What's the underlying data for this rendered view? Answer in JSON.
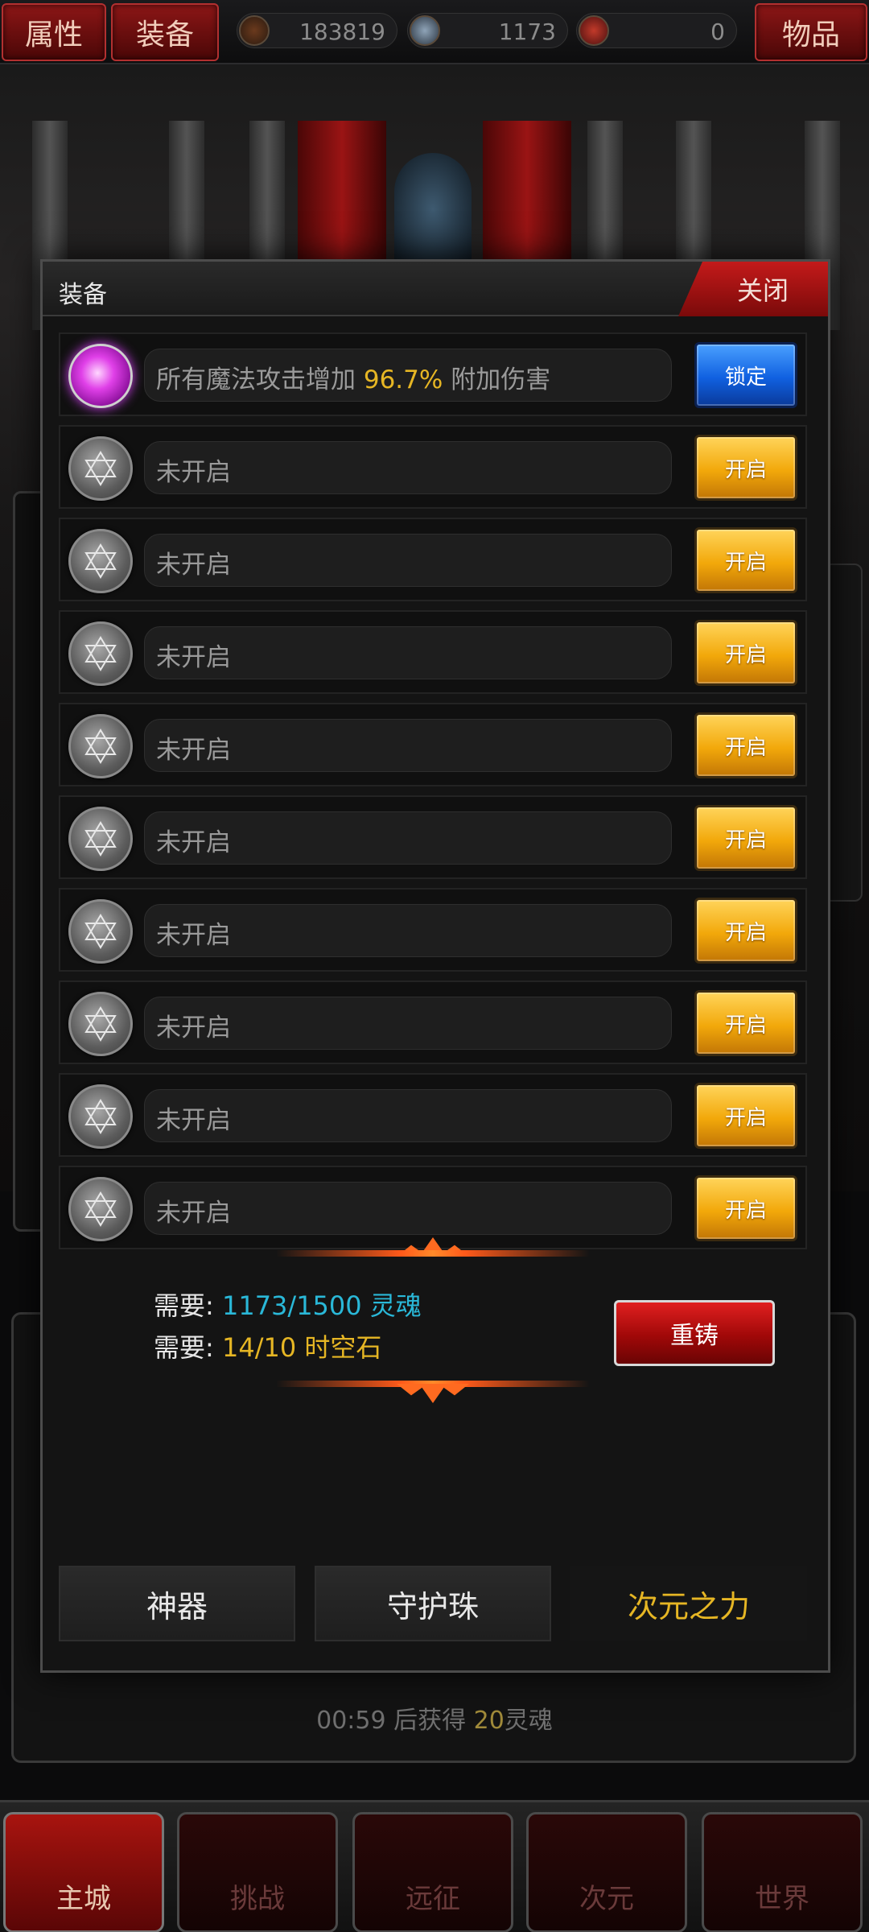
{
  "topbar": {
    "attributes_label": "属性",
    "equipment_label": "装备",
    "items_label": "物品",
    "gold": "183819",
    "souls": "1173",
    "space_time_stones": "0"
  },
  "modal": {
    "title": "装备",
    "close_label": "关闭",
    "slots": [
      {
        "prefix": "所有魔法攻击增加 ",
        "value": "96.7%",
        "suffix": " 附加伤害",
        "button": "锁定",
        "state": "unlocked"
      },
      {
        "text": "未开启",
        "button": "开启",
        "state": "locked"
      },
      {
        "text": "未开启",
        "button": "开启",
        "state": "locked"
      },
      {
        "text": "未开启",
        "button": "开启",
        "state": "locked"
      },
      {
        "text": "未开启",
        "button": "开启",
        "state": "locked"
      },
      {
        "text": "未开启",
        "button": "开启",
        "state": "locked"
      },
      {
        "text": "未开启",
        "button": "开启",
        "state": "locked"
      },
      {
        "text": "未开启",
        "button": "开启",
        "state": "locked"
      },
      {
        "text": "未开启",
        "button": "开启",
        "state": "locked"
      },
      {
        "text": "未开启",
        "button": "开启",
        "state": "locked"
      }
    ],
    "requirements": {
      "label": "需要: ",
      "soul_value": "1173/1500 灵魂",
      "stone_value": "14/10 时空石"
    },
    "reforge_label": "重铸",
    "tabs": [
      "神器",
      "守护珠",
      "次元之力"
    ],
    "active_tab": 2
  },
  "status": {
    "time": "00:59",
    "text": " 后获得 ",
    "amount": "20",
    "unit": "灵魂"
  },
  "bottom_nav": [
    "主城",
    "挑战",
    "远征",
    "次元",
    "世界"
  ],
  "colors": {
    "accent_gold": "#e6b624",
    "accent_blue": "#2ab8d8",
    "close_red": "#c41a1a"
  }
}
